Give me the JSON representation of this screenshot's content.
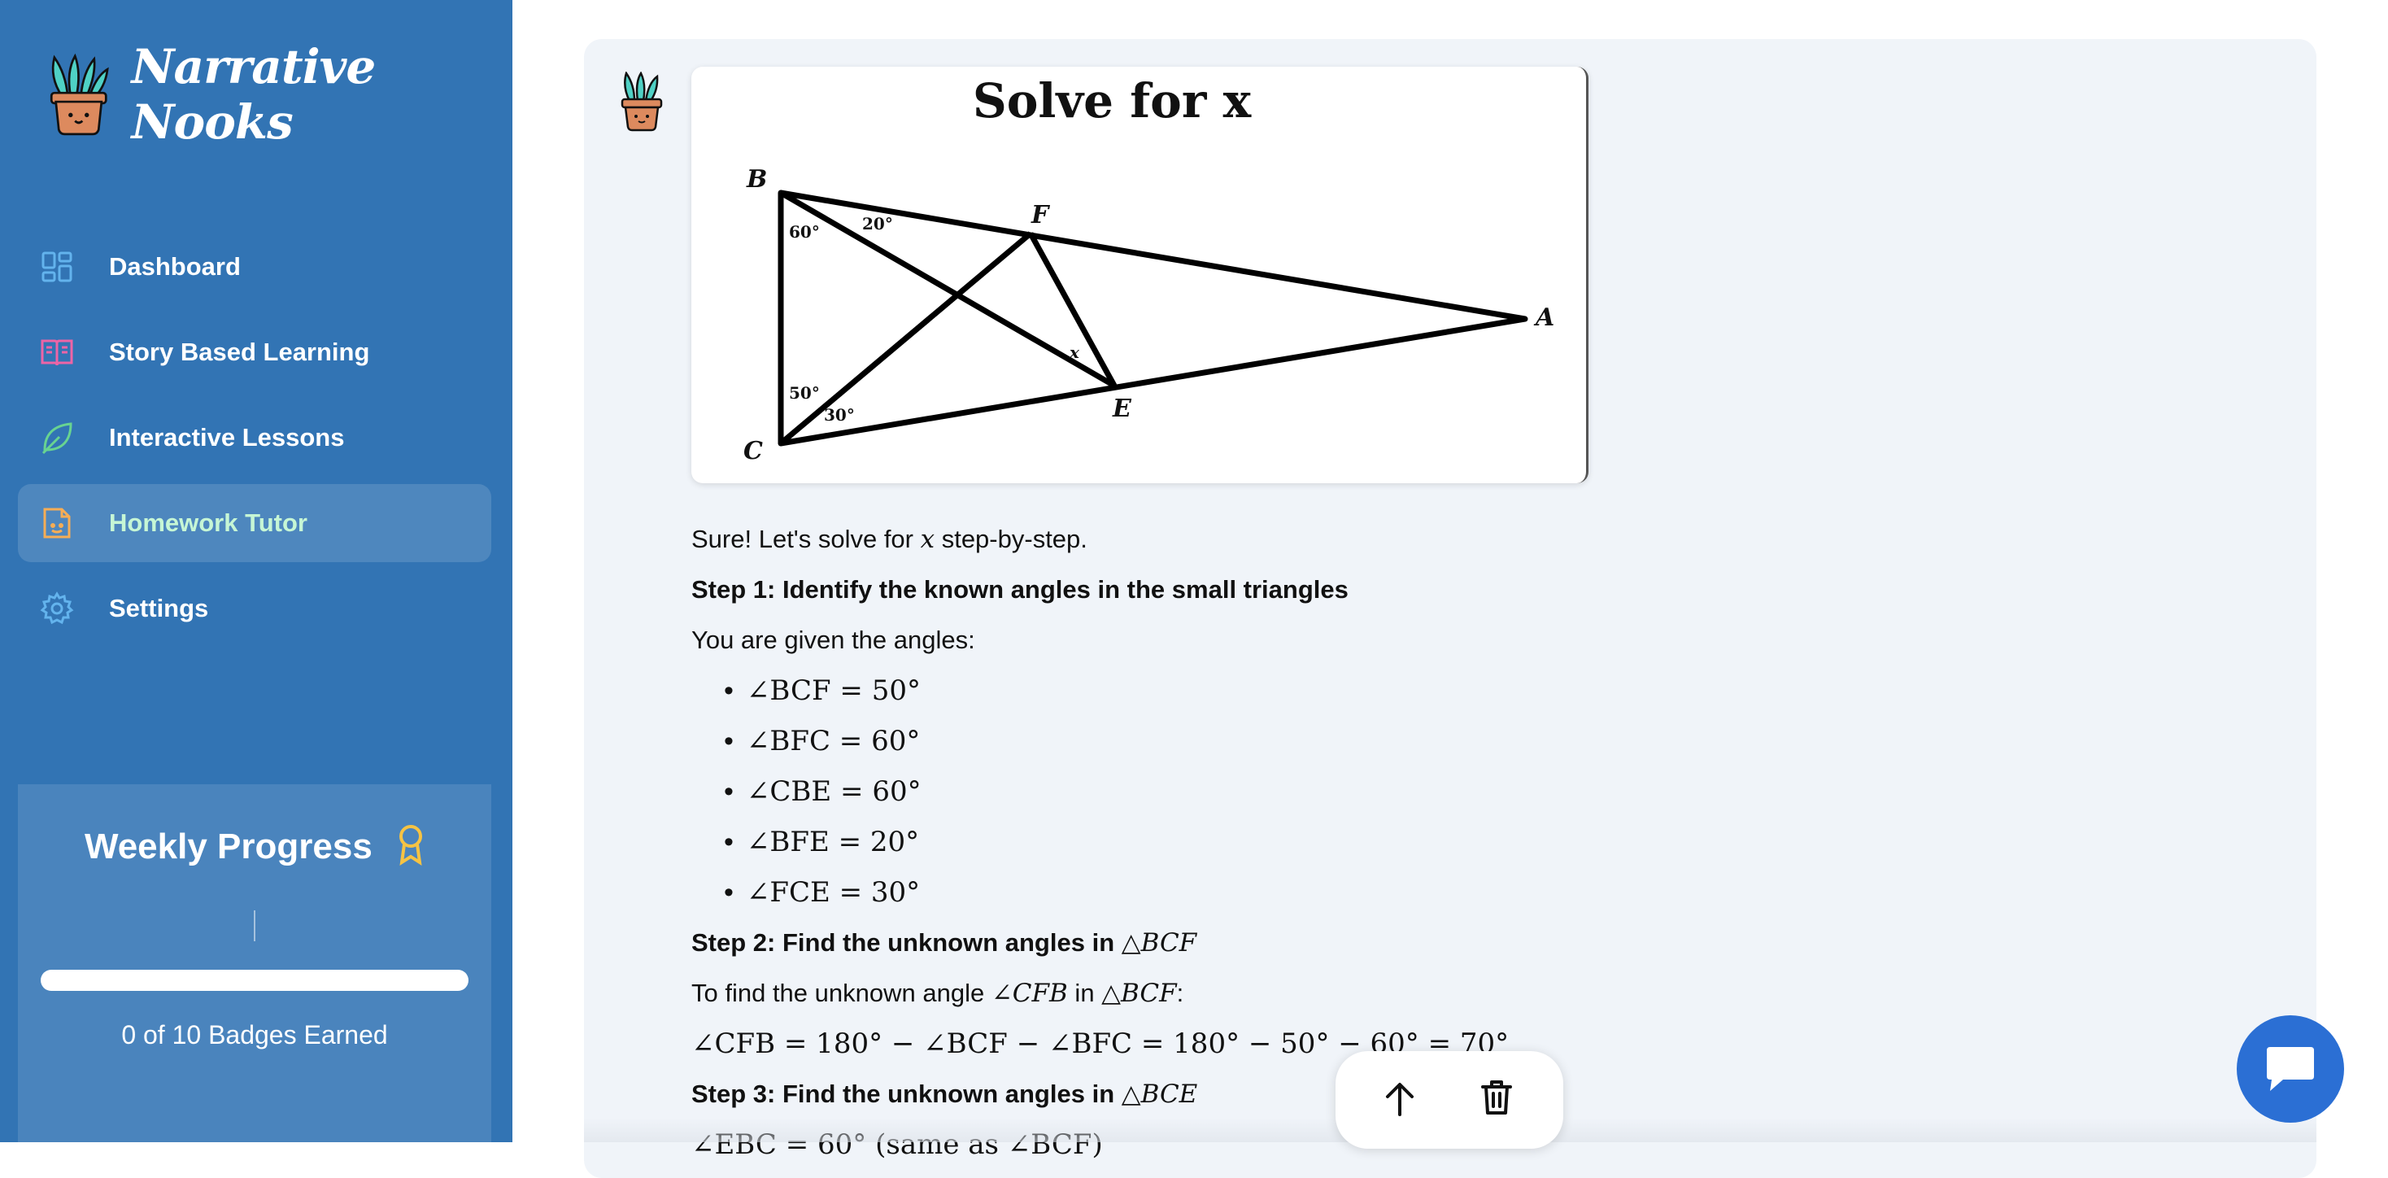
{
  "app": {
    "name": "Narrative Nooks"
  },
  "sidebar": {
    "items": [
      {
        "label": "Dashboard",
        "icon": "dashboard-grid-icon",
        "color": "#63b3ed"
      },
      {
        "label": "Story Based Learning",
        "icon": "open-book-icon",
        "color": "#ed64a6"
      },
      {
        "label": "Interactive Lessons",
        "icon": "leaf-icon",
        "color": "#68d391"
      },
      {
        "label": "Homework Tutor",
        "icon": "homework-icon",
        "color": "#f6ad55",
        "active": true
      },
      {
        "label": "Settings",
        "icon": "gear-icon",
        "color": "#63b3ed"
      }
    ],
    "progress": {
      "title": "Weekly Progress",
      "badges_earned": 0,
      "badges_total": 10,
      "badges_text": "0 of 10 Badges Earned",
      "fraction": 0
    }
  },
  "figure": {
    "title": "Solve for x",
    "points": [
      "B",
      "F",
      "A",
      "C",
      "E"
    ],
    "angles": [
      "60°",
      "20°",
      "50°",
      "30°",
      "x"
    ]
  },
  "content": {
    "intro_pre": "Sure! Let's solve for ",
    "intro_var": "x",
    "intro_post": " step-by-step.",
    "step1": "Step 1: Identify the known angles in the small triangles",
    "given": "You are given the angles:",
    "given_angles": [
      "∠BCF = 50°",
      "∠BFC = 60°",
      "∠CBE = 60°",
      "∠BFE = 20°",
      "∠FCE = 30°"
    ],
    "step2_pre": "Step 2: Find the unknown angles in ",
    "step2_tri": "△BCF",
    "find_pre": "To find the unknown angle ",
    "find_angle": "∠CFB",
    "find_mid": " in ",
    "find_tri": "△BCF",
    "find_post": ":",
    "equation": "∠CFB = 180° − ∠BCF − ∠BFC = 180° − 50° − 60° = 70°",
    "step3_pre": "Step 3: Find the unknown angles in ",
    "step3_tri": "△BCE",
    "partial": "∠EBC = 60° (same as ∠BCF)"
  }
}
